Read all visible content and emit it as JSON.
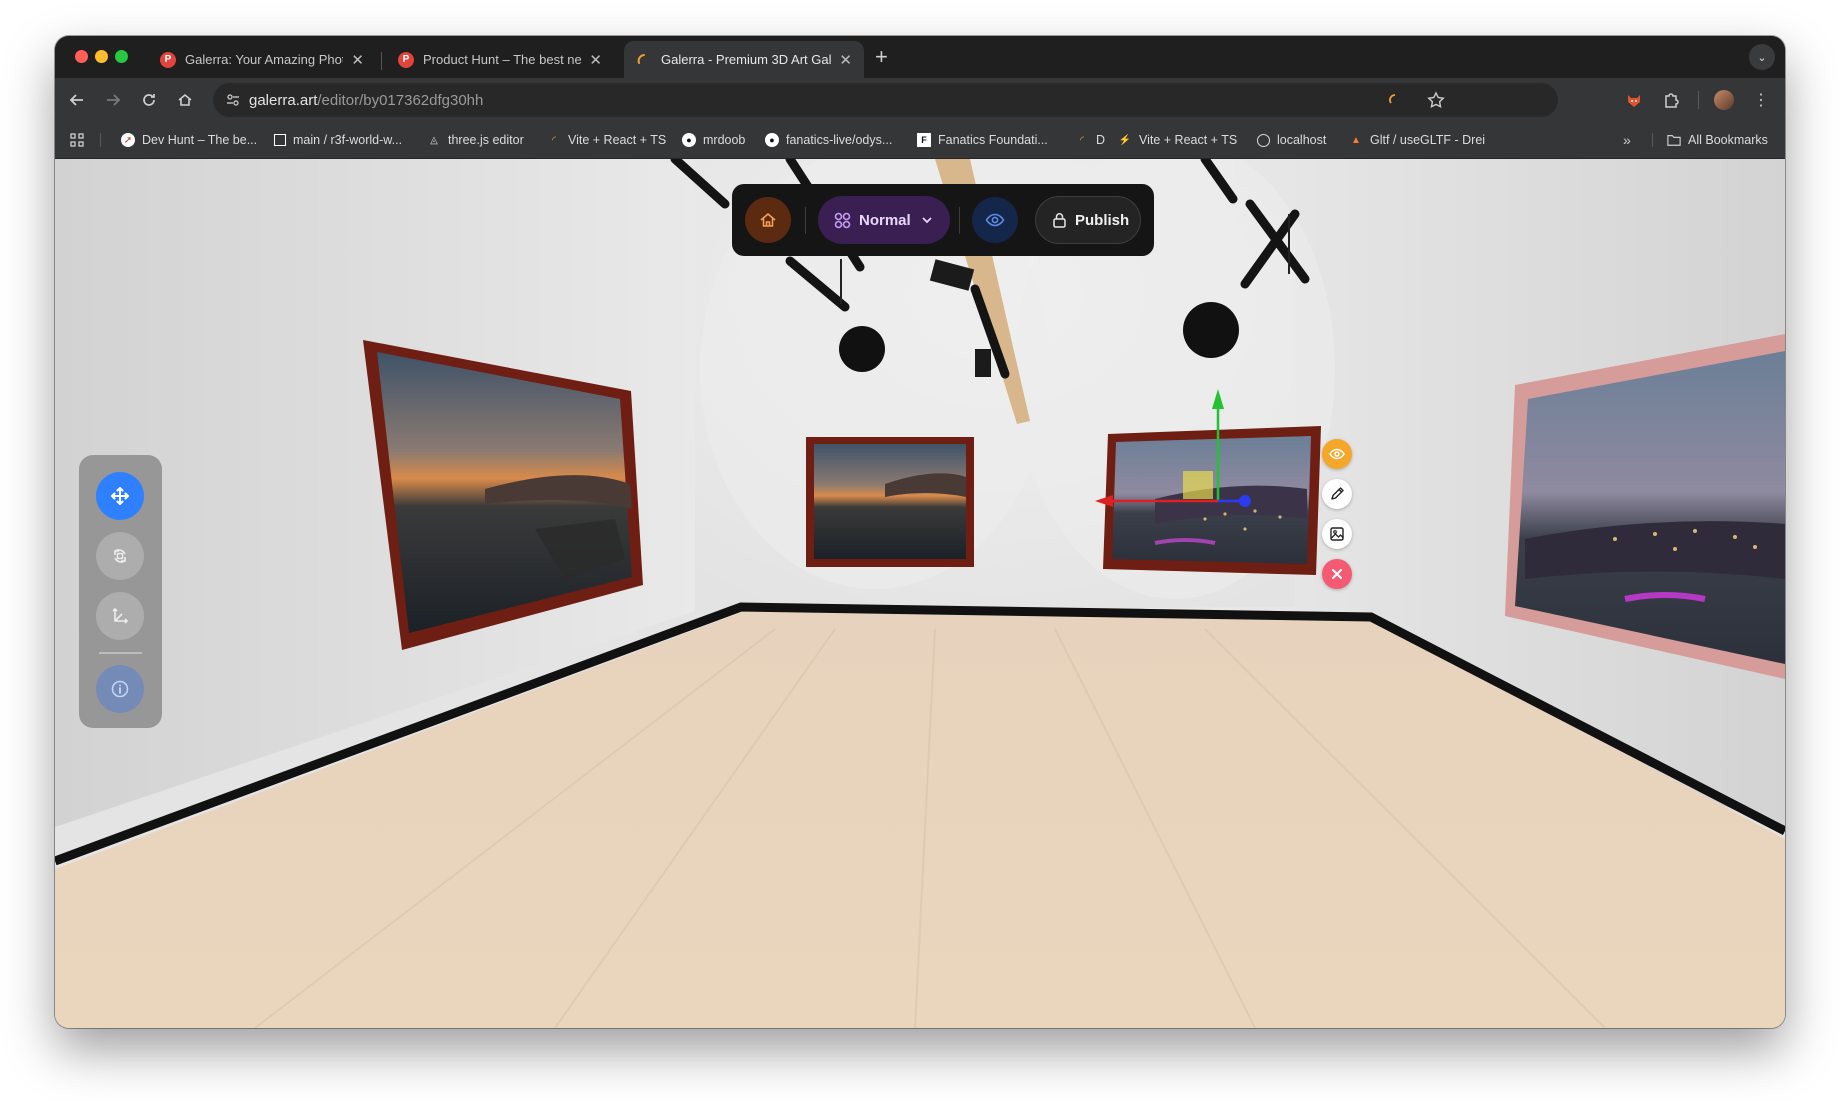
{
  "tabs": [
    {
      "title": "Galerra: Your Amazing Photos",
      "favicon": "P",
      "active": false
    },
    {
      "title": "Product Hunt – The best new",
      "favicon": "P",
      "active": false
    },
    {
      "title": "Galerra - Premium 3D Art Gal",
      "favicon": "spinner",
      "active": true
    }
  ],
  "omnibox": {
    "domain": "galerra.art",
    "path": "/editor/by017362dfg30hh"
  },
  "bookmarks": [
    {
      "label": "Dev Hunt – The be...",
      "icon": "devhunt-icon"
    },
    {
      "label": "main / r3f-world-w...",
      "icon": "square-icon"
    },
    {
      "label": "three.js editor",
      "icon": "threejs-icon"
    },
    {
      "label": "Vite + React + TS",
      "icon": "loading-icon"
    },
    {
      "label": "mrdoob",
      "icon": "github-icon"
    },
    {
      "label": "fanatics-live/odys...",
      "icon": "github-icon"
    },
    {
      "label": "Fanatics Foundati...",
      "icon": "fanatics-icon"
    },
    {
      "label": "D",
      "icon": "loading-icon"
    },
    {
      "label": "Vite + React + TS",
      "icon": "vite-icon"
    },
    {
      "label": "localhost",
      "icon": "globe-icon"
    },
    {
      "label": "Gltf / useGLTF - Drei",
      "icon": "drei-icon"
    }
  ],
  "all_bookmarks_label": "All Bookmarks",
  "editor": {
    "mode_label": "Normal",
    "publish_label": "Publish",
    "tools": [
      "move",
      "rotate",
      "scale",
      "info"
    ],
    "active_tool": "move",
    "actions": [
      "visibility",
      "edit",
      "replace-image",
      "delete"
    ]
  },
  "colors": {
    "home_accent": "#f5a056",
    "mode_accent": "#c89cf5",
    "eye_accent": "#5d8be6",
    "tool_active": "#2f80ff",
    "visibility_button": "#f5a72a",
    "delete_button": "#f45b73"
  }
}
